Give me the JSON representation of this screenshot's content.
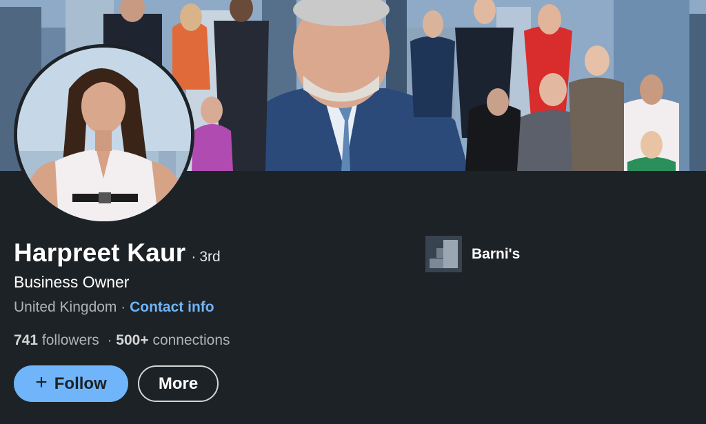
{
  "profile": {
    "name": "Harpreet Kaur",
    "degree": "3rd",
    "degree_separator": "·",
    "headline": "Business Owner",
    "location": "United Kingdom",
    "location_separator": "·",
    "contact_label": "Contact info",
    "followers_count": "741",
    "followers_label": "followers",
    "stats_separator": "·",
    "connections_count": "500+",
    "connections_label": "connections"
  },
  "actions": {
    "follow_icon": "+",
    "follow_label": "Follow",
    "more_label": "More"
  },
  "company": {
    "name": "Barni's",
    "logo_icon": "company-logo-icon"
  },
  "colors": {
    "background": "#1d2226",
    "accent": "#70b5f9",
    "secondary_text": "#b0b3b6"
  }
}
